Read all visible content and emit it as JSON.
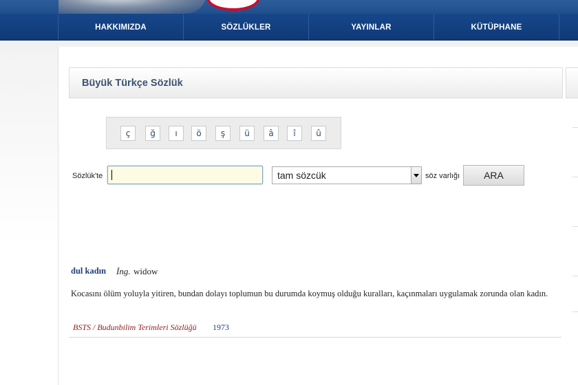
{
  "nav": {
    "items": [
      "HAKKIMIZDA",
      "SÖZLÜKLER",
      "YAYINLAR",
      "KÜTÜPHANE",
      ""
    ]
  },
  "panel": {
    "title": "Büyük Türkçe Sözlük"
  },
  "special_chars": [
    "ç",
    "ğ",
    "ı",
    "ö",
    "ş",
    "ü",
    "â",
    "î",
    "û"
  ],
  "search": {
    "label": "Sözlük'te",
    "input_value": "",
    "select_value": "tam sözcük",
    "scope_label": "söz varlığı",
    "button_label": "ARA"
  },
  "result": {
    "term": "dul kadın",
    "lang_abbr": "İng.",
    "translation": "widow",
    "definition": "Kocasını ölüm yoluyla yitiren, bundan dolayı toplumun bu durumda koymuş olduğu kuralları, kaçınmaları uygulamak zorunda olan kadın.",
    "source": "BSTS / Budunbilim Terimleri Sözlüğü",
    "year": "1973"
  },
  "colors": {
    "nav_bg": "#16468a",
    "title_text": "#3a5270",
    "term_text": "#1f3f7a",
    "source_text": "#8b1a1a",
    "input_bg": "#fdfbe3"
  }
}
